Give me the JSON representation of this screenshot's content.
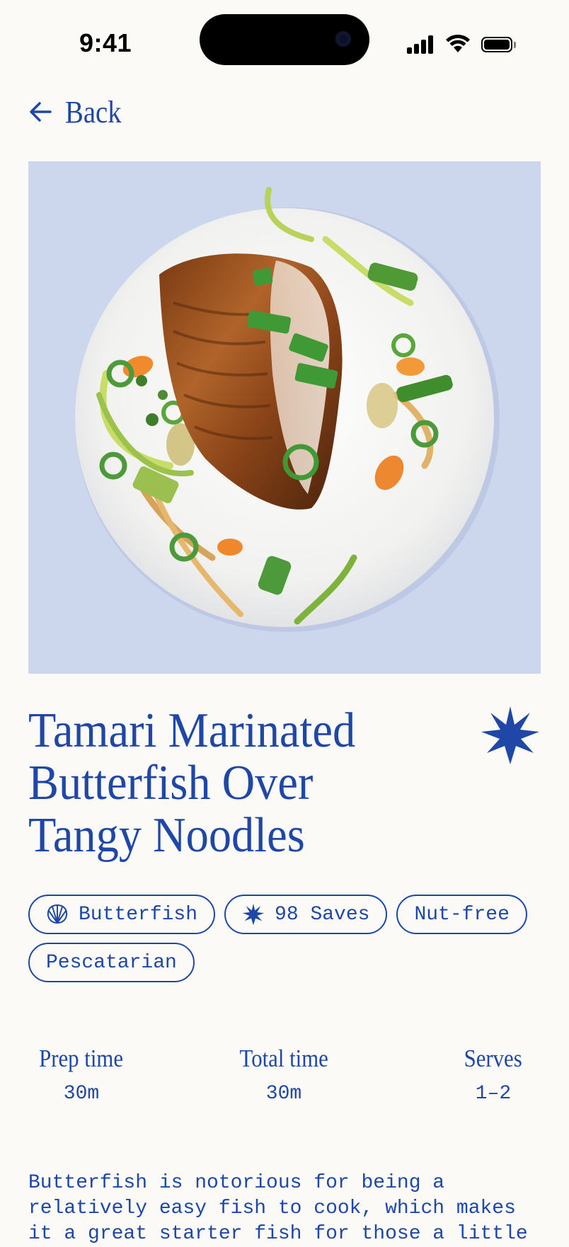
{
  "status_bar": {
    "time": "9:41"
  },
  "nav": {
    "back_label": "Back"
  },
  "recipe": {
    "title": "Tamari Marinated\nButterfish Over\nTangy Noodles",
    "tags": [
      {
        "label": "Butterfish",
        "icon": "shell-icon"
      },
      {
        "label": "98 Saves",
        "icon": "star-icon"
      },
      {
        "label": "Nut-free"
      },
      {
        "label": "Pescatarian"
      }
    ],
    "stats": {
      "prep": {
        "label": "Prep time",
        "value": "30m"
      },
      "total": {
        "label": "Total time",
        "value": "30m"
      },
      "serves": {
        "label": "Serves",
        "value": "1–2"
      }
    },
    "description": "Butterfish is notorious for being a relatively easy fish to cook, which makes it a great starter fish for those a little"
  },
  "colors": {
    "accent": "#1f47a8",
    "hero_bg": "#ccd7ed",
    "page_bg": "#fbfaf7"
  }
}
